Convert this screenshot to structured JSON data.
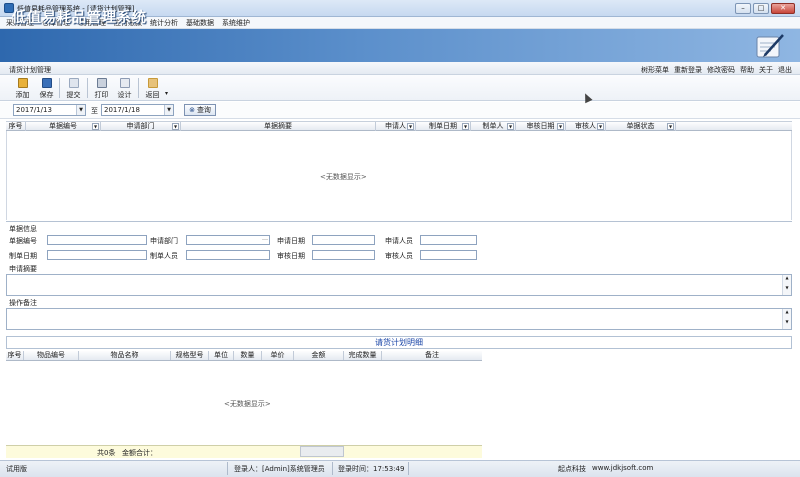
{
  "window": {
    "title": "低值易耗品管理系统 - [请货计划管理]",
    "controls": {
      "minimize": "–",
      "maximize": "□",
      "close": "✕"
    }
  },
  "menu": [
    "采购管理",
    "仓库管理",
    "领用管理",
    "应付账款",
    "统计分析",
    "基础数据",
    "系统维护"
  ],
  "banner": {
    "title": "低值易耗品管理系统"
  },
  "subbar": {
    "module": "请货计划管理",
    "links": [
      "树形菜单",
      "重新登录",
      "修改密码",
      "帮助",
      "关于",
      "退出"
    ]
  },
  "toolbar": {
    "buttons": [
      {
        "label": "添加",
        "icon": "add-doc-icon",
        "color": "#e8b13a"
      },
      {
        "label": "保存",
        "icon": "save-icon",
        "color": "#3a6fb8"
      },
      {
        "label": "提交",
        "icon": "submit-icon",
        "color": "#9aa9bf"
      },
      {
        "label": "打印",
        "icon": "print-icon",
        "color": "#6b7b93"
      },
      {
        "label": "设计",
        "icon": "design-icon",
        "color": "#8d9bb3"
      },
      {
        "label": "返回",
        "icon": "back-icon",
        "color": "#c79a3a"
      }
    ],
    "more": "▾"
  },
  "filter": {
    "start_date": "2017/1/13",
    "to_label": "至",
    "end_date": "2017/1/18",
    "query_label": "查询"
  },
  "main_grid": {
    "columns": [
      "序号",
      "单据编号",
      "申请部门",
      "单据摘要",
      "申请人",
      "制单日期",
      "制单人",
      "审核日期",
      "审核人",
      "单据状态"
    ],
    "empty_text": "<无数据显示>"
  },
  "form": {
    "section_title": "单据信息",
    "row1": {
      "doc_no": "单据编号",
      "dept": "申请部门",
      "apply_date": "申请日期",
      "applicant": "申请人员"
    },
    "row2": {
      "create_date": "制单日期",
      "creator": "制单人员",
      "audit_date": "审核日期",
      "auditor": "审核人员"
    },
    "summary_label": "申请摘要",
    "remark_label": "操作备注"
  },
  "detail": {
    "title": "请货计划明细",
    "columns": [
      "序号",
      "物品编号",
      "物品名称",
      "规格型号",
      "单位",
      "数量",
      "单价",
      "金额",
      "完成数量",
      "备注"
    ],
    "empty_text": "<无数据显示>",
    "footer": {
      "count": "共0条",
      "total_label": "金额合计："
    }
  },
  "statusbar": {
    "edition": "试用版",
    "user": "登录人：[Admin]系统管理员",
    "login_time": "登录时间：17:53:49",
    "company": "起点科技",
    "website": "www.jdkjsoft.com"
  }
}
